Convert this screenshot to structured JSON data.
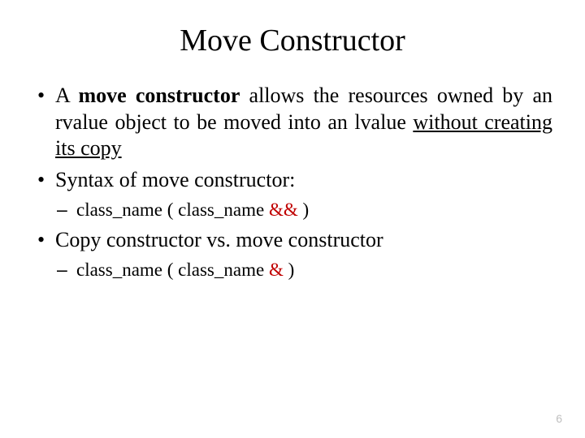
{
  "title": "Move Constructor",
  "b1": {
    "pre": "A ",
    "bold": "move constructor",
    "mid": " allows the resources owned by an rvalue object to be moved into an lvalue ",
    "underline": "without creating its copy"
  },
  "b2": "Syntax of move constructor:",
  "b2s1": {
    "text": "class_name ( class_name ",
    "amp": "&&",
    "close": " )"
  },
  "b3": "Copy constructor vs. move constructor",
  "b3s1": {
    "text": "class_name ( class_name ",
    "amp": "&",
    "close": " )"
  },
  "pagenum": "6"
}
